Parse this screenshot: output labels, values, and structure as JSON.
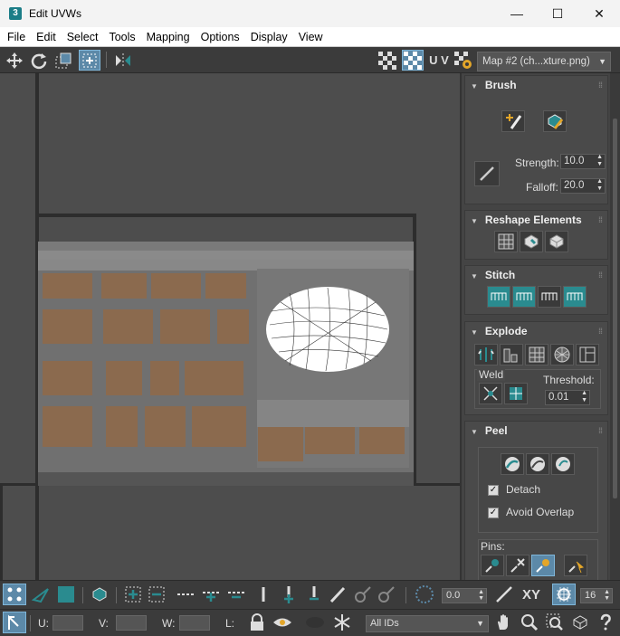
{
  "window": {
    "app_icon": "3",
    "title": "Edit UVWs",
    "minimize": "—",
    "maximize": "☐",
    "close": "✕"
  },
  "menu": [
    "File",
    "Edit",
    "Select",
    "Tools",
    "Mapping",
    "Options",
    "Display",
    "View"
  ],
  "toolbar": {
    "uv_label": "U V",
    "map_select": "Map #2 (ch...xture.png)",
    "icons": [
      "move-icon",
      "rotate-icon",
      "scale-icon",
      "freeform-icon",
      "mirror-icon",
      "checker-pattern-icon",
      "checker-active-icon",
      "uv-toggle",
      "map-settings-icon"
    ]
  },
  "panel": {
    "brush": {
      "title": "Brush",
      "strength_label": "Strength:",
      "strength_value": "10.0",
      "falloff_label": "Falloff:",
      "falloff_value": "20.0"
    },
    "reshape": {
      "title": "Reshape Elements"
    },
    "stitch": {
      "title": "Stitch"
    },
    "explode": {
      "title": "Explode",
      "weld_label": "Weld",
      "threshold_label": "Threshold:",
      "threshold_value": "0.01"
    },
    "peel": {
      "title": "Peel",
      "detach_label": "Detach",
      "detach_checked": true,
      "avoid_overlap_label": "Avoid Overlap",
      "avoid_overlap_checked": true,
      "pins_label": "Pins:"
    }
  },
  "bottom1": {
    "angle_value": "0.0",
    "xy_label": "XY",
    "grid_value": "16"
  },
  "bottom2": {
    "u_label": "U:",
    "u_value": "",
    "v_label": "V:",
    "v_value": "",
    "w_label": "W:",
    "w_value": "",
    "l_label": "L:",
    "ids_select": "All IDs"
  },
  "colors": {
    "accent": "#5c89a8",
    "teal": "#2a8b8f",
    "panel": "#444444",
    "viewport": "#4d4d4d"
  }
}
